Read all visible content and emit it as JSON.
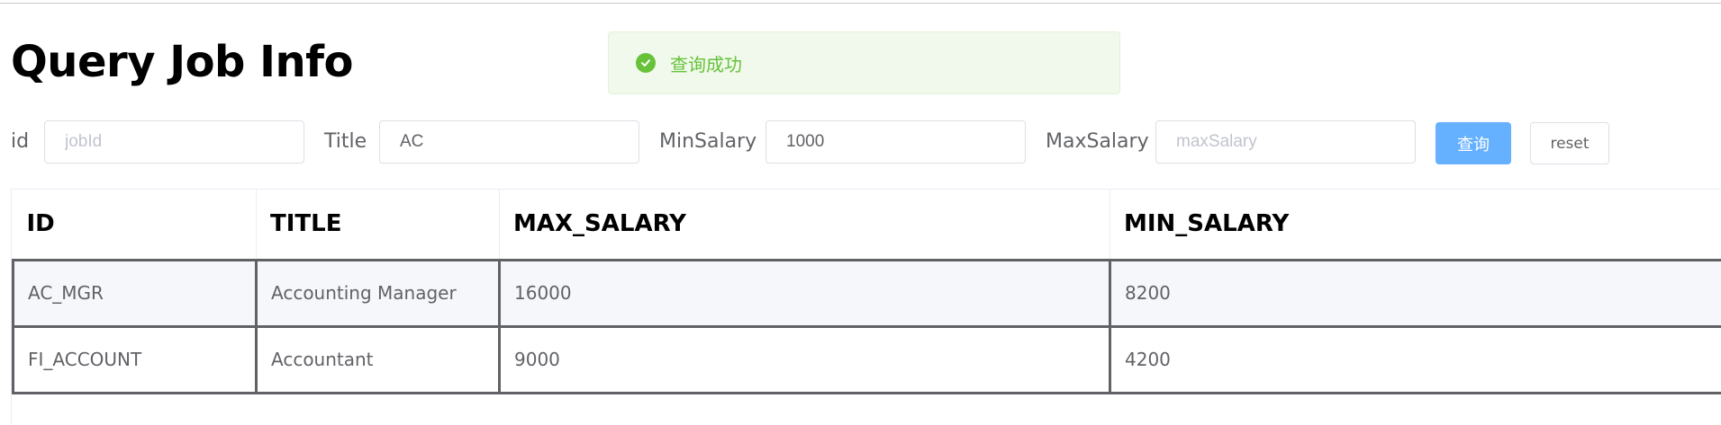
{
  "page": {
    "title": "Query Job Info"
  },
  "toast": {
    "icon": "check-circle-icon",
    "message": "查询成功",
    "color": "#67c23a"
  },
  "filters": {
    "id": {
      "label": "id",
      "value": "",
      "placeholder": "jobId"
    },
    "title": {
      "label": "Title",
      "value": "AC",
      "placeholder": ""
    },
    "min_salary": {
      "label": "MinSalary",
      "value": "1000",
      "placeholder": ""
    },
    "max_salary": {
      "label": "MaxSalary",
      "value": "",
      "placeholder": "maxSalary"
    },
    "query_label": "查询",
    "reset_label": "reset"
  },
  "table": {
    "columns": [
      "ID",
      "TITLE",
      "MAX_SALARY",
      "MIN_SALARY"
    ],
    "rows": [
      [
        "AC_MGR",
        "Accounting Manager",
        "16000",
        "8200"
      ],
      [
        "FI_ACCOUNT",
        "Accountant",
        "9000",
        "4200"
      ]
    ]
  },
  "colors": {
    "primary_button": "#66b1ff",
    "success": "#67c23a",
    "stripe_row": "#f5f7fa"
  }
}
